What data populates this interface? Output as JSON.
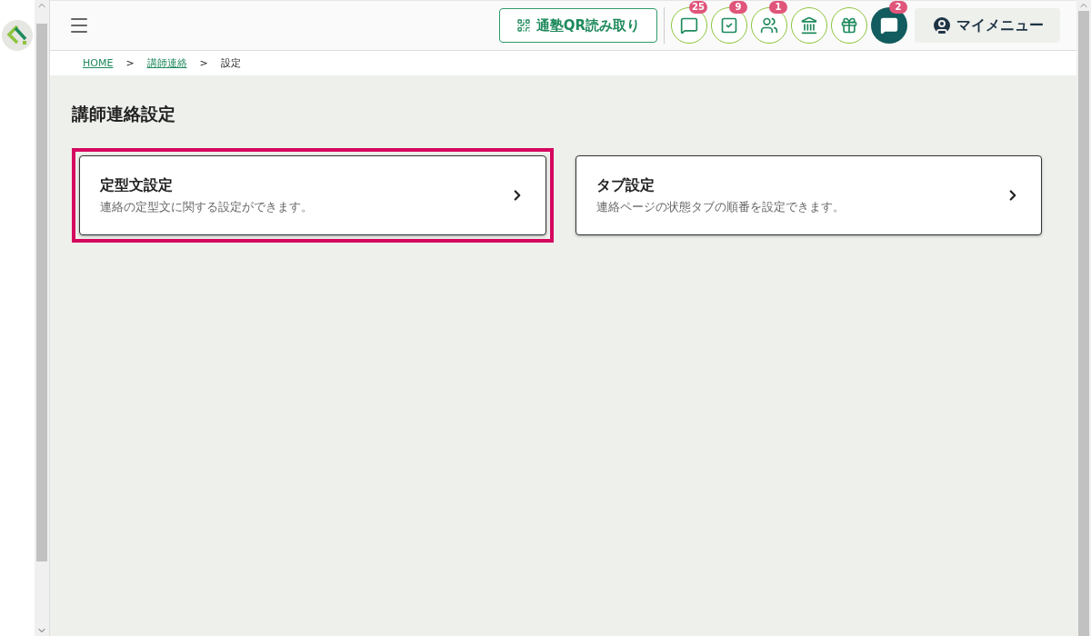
{
  "header": {
    "qr_button": "通塾QR読み取り",
    "icon_buttons": [
      {
        "kind": "chat",
        "badge": "25",
        "filled": false
      },
      {
        "kind": "checklist",
        "badge": "9",
        "filled": false
      },
      {
        "kind": "people",
        "badge": "1",
        "filled": false
      },
      {
        "kind": "building",
        "filled": false
      },
      {
        "kind": "gift",
        "filled": false
      },
      {
        "kind": "chat",
        "badge": "2",
        "filled": true
      }
    ],
    "my_menu": "マイメニュー"
  },
  "breadcrumb": [
    {
      "label": "HOME",
      "link": true
    },
    {
      "label": ">",
      "link": false
    },
    {
      "label": "講師連絡",
      "link": true
    },
    {
      "label": ">",
      "link": false
    },
    {
      "label": "設定",
      "link": false
    }
  ],
  "page_title": "講師連絡設定",
  "cards": [
    {
      "title": "定型文設定",
      "description": "連絡の定型文に関する設定ができます。",
      "highlighted": true
    },
    {
      "title": "タブ設定",
      "description": "連絡ページの状態タブの順番を設定できます。",
      "highlighted": false
    }
  ]
}
